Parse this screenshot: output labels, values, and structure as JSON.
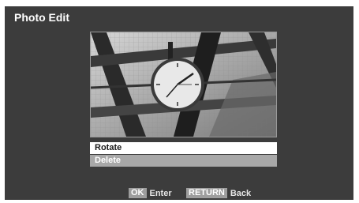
{
  "header": {
    "title": "Photo Edit"
  },
  "preview": {
    "image": "station-clock-photo"
  },
  "menu": {
    "items": [
      {
        "label": "Rotate",
        "state": "selected"
      },
      {
        "label": "Delete",
        "state": "normal"
      }
    ]
  },
  "footer": {
    "ok_key": "OK",
    "ok_action": "Enter",
    "return_key": "RETURN",
    "return_action": "Back"
  }
}
